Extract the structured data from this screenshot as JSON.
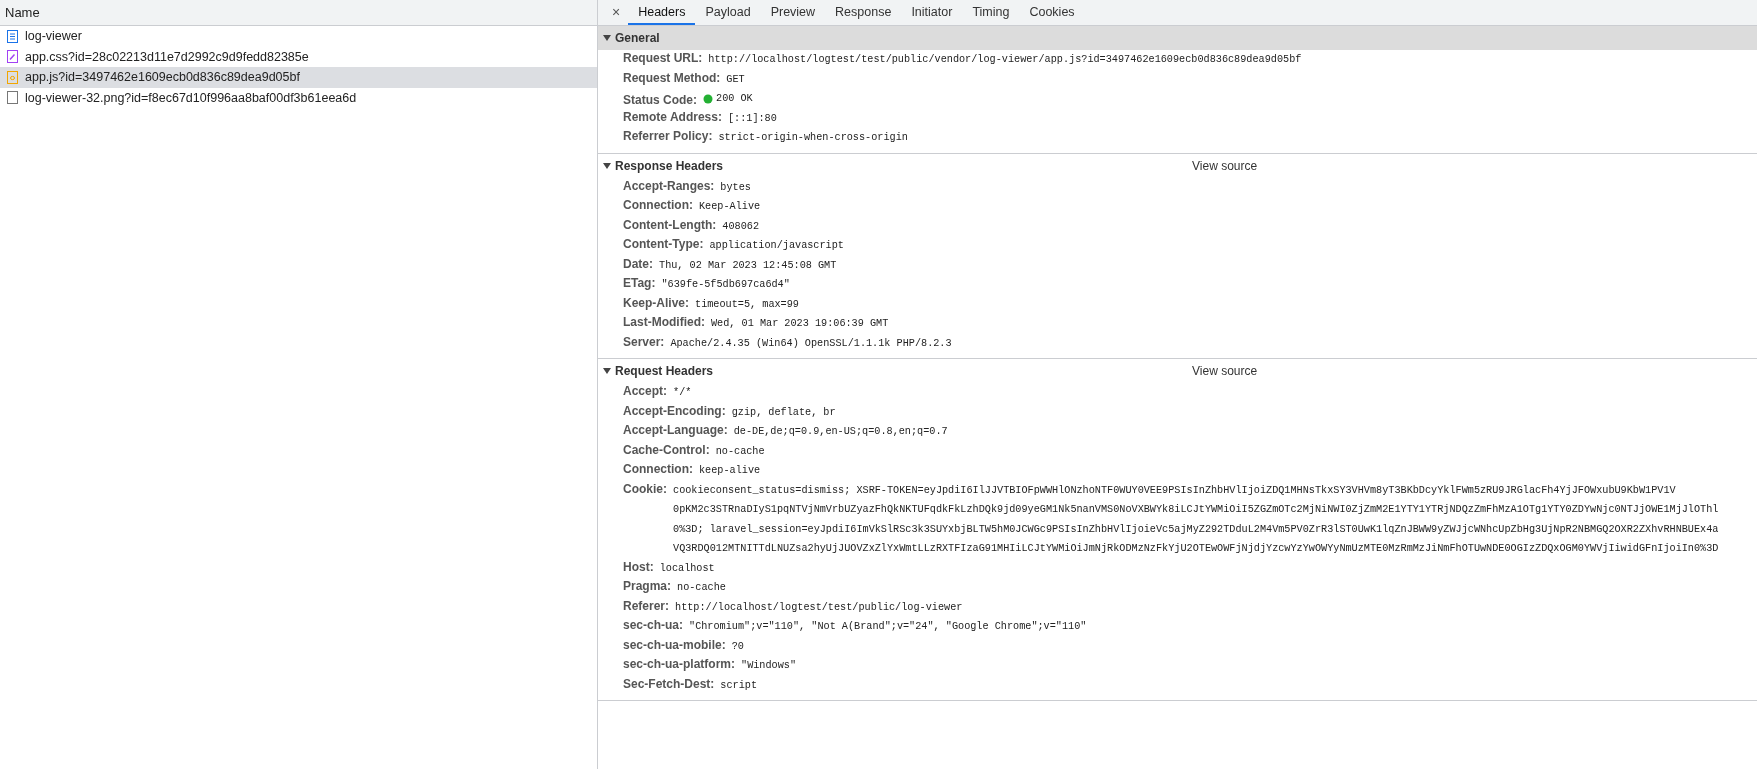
{
  "requests": {
    "column_header": "Name",
    "items": [
      {
        "name": "log-viewer",
        "kind": "document",
        "selected": false
      },
      {
        "name": "app.css?id=28c02213d11e7d2992c9d9fedd82385e",
        "kind": "stylesheet",
        "selected": false
      },
      {
        "name": "app.js?id=3497462e1609ecb0d836c89dea9d05bf",
        "kind": "script",
        "selected": true
      },
      {
        "name": "log-viewer-32.png?id=f8ec67d10f996aa8baf00df3b61eea6d",
        "kind": "image",
        "selected": false
      }
    ]
  },
  "details": {
    "close": "×",
    "tabs": [
      {
        "label": "Headers",
        "selected": true
      },
      {
        "label": "Payload",
        "selected": false
      },
      {
        "label": "Preview",
        "selected": false
      },
      {
        "label": "Response",
        "selected": false
      },
      {
        "label": "Initiator",
        "selected": false
      },
      {
        "label": "Timing",
        "selected": false
      },
      {
        "label": "Cookies",
        "selected": false
      }
    ],
    "sections": [
      {
        "title": "General",
        "expanded": true,
        "shaded": true,
        "rows": [
          {
            "kind": "plain",
            "name": "Request URL:",
            "value": [
              "http://localhost/logtest/test/public/vendor/log-viewer/app.js?id=3497462e1609ecb0d836c89dea9d05bf"
            ]
          },
          {
            "kind": "plain",
            "name": "Request Method:",
            "value": [
              "GET"
            ]
          },
          {
            "kind": "status",
            "name": "Status Code:",
            "value": [
              "200 OK"
            ]
          },
          {
            "kind": "plain",
            "name": "Remote Address:",
            "value": [
              "[::1]:80"
            ]
          },
          {
            "kind": "plain",
            "name": "Referrer Policy:",
            "value": [
              "strict-origin-when-cross-origin"
            ]
          }
        ]
      },
      {
        "title": "Response Headers",
        "expanded": true,
        "shaded": false,
        "link": "View source",
        "rows": [
          {
            "kind": "plain",
            "name": "Accept-Ranges:",
            "value": [
              "bytes"
            ]
          },
          {
            "kind": "plain",
            "name": "Connection:",
            "value": [
              "Keep-Alive"
            ]
          },
          {
            "kind": "plain",
            "name": "Content-Length:",
            "value": [
              "408062"
            ]
          },
          {
            "kind": "plain",
            "name": "Content-Type:",
            "value": [
              "application/javascript"
            ]
          },
          {
            "kind": "plain",
            "name": "Date:",
            "value": [
              "Thu, 02 Mar 2023 12:45:08 GMT"
            ]
          },
          {
            "kind": "plain",
            "name": "ETag:",
            "value": [
              "\"639fe-5f5db697ca6d4\""
            ]
          },
          {
            "kind": "plain",
            "name": "Keep-Alive:",
            "value": [
              "timeout=5, max=99"
            ]
          },
          {
            "kind": "plain",
            "name": "Last-Modified:",
            "value": [
              "Wed, 01 Mar 2023 19:06:39 GMT"
            ]
          },
          {
            "kind": "plain",
            "name": "Server:",
            "value": [
              "Apache/2.4.35 (Win64) OpenSSL/1.1.1k PHP/8.2.3"
            ]
          }
        ]
      },
      {
        "title": "Request Headers",
        "expanded": true,
        "shaded": false,
        "link": "View source",
        "rows": [
          {
            "kind": "plain",
            "name": "Accept:",
            "value": [
              "*/*"
            ]
          },
          {
            "kind": "plain",
            "name": "Accept-Encoding:",
            "value": [
              "gzip, deflate, br"
            ]
          },
          {
            "kind": "plain",
            "name": "Accept-Language:",
            "value": [
              "de-DE,de;q=0.9,en-US;q=0.8,en;q=0.7"
            ]
          },
          {
            "kind": "plain",
            "name": "Cache-Control:",
            "value": [
              "no-cache"
            ]
          },
          {
            "kind": "plain",
            "name": "Connection:",
            "value": [
              "keep-alive"
            ]
          },
          {
            "kind": "plain",
            "name": "Cookie:",
            "value": [
              "cookieconsent_status=dismiss; XSRF-TOKEN=eyJpdiI6IlJJVTBIOFpWWHlONzhoNTF0WUY0VEE9PSIsInZhbHVlIjoiZDQ1MHNsTkxSY3VHVm8yT3BKbDcyYklFWm5zRU9JRGlacFh4YjJFOWxubU9KbW1PV1V",
              "0pKM2c3STRnaDIyS1pqNTVjNmVrbUZyazFhQkNKTUFqdkFkLzhDQk9jd09yeGM1Nk5nanVMS0NoVXBWYk8iLCJtYWMiOiI5ZGZmOTc2MjNiNWI0ZjZmM2E1YTY1YTRjNDQzZmFhMzA1OTg1YTY0ZDYwNjc0NTJjOWE1MjJlOThl",
              "0%3D; laravel_session=eyJpdiI6ImVkSlRSc3k3SUYxbjBLTW5hM0JCWGc9PSIsInZhbHVlIjoieVc5ajMyZ292TDduL2M4Vm5PV0ZrR3lST0UwK1lqZnJBWW9yZWJjcWNhcUpZbHg3UjNpR2NBMGQ2OXR2ZXhvRHNBUEx4a",
              "VQ3RDQ012MTNITTdLNUZsa2hyUjJUOVZxZlYxWmtLLzRXTFIzaG91MHIiLCJtYWMiOiJmNjRkODMzNzFkYjU2OTEwOWFjNjdjYzcwYzYwOWYyNmUzMTE0MzRmMzJiNmFhOTUwNDE0OGIzZDQxOGM0YWVjIiwidGFnIjoiIn0%3D"
            ]
          },
          {
            "kind": "plain",
            "name": "Host:",
            "value": [
              "localhost"
            ]
          },
          {
            "kind": "plain",
            "name": "Pragma:",
            "value": [
              "no-cache"
            ]
          },
          {
            "kind": "plain",
            "name": "Referer:",
            "value": [
              "http://localhost/logtest/test/public/log-viewer"
            ]
          },
          {
            "kind": "plain",
            "name": "sec-ch-ua:",
            "value": [
              "\"Chromium\";v=\"110\", \"Not A(Brand\";v=\"24\", \"Google Chrome\";v=\"110\""
            ]
          },
          {
            "kind": "plain",
            "name": "sec-ch-ua-mobile:",
            "value": [
              "?0"
            ]
          },
          {
            "kind": "plain",
            "name": "sec-ch-ua-platform:",
            "value": [
              "\"Windows\""
            ]
          },
          {
            "kind": "plain",
            "name": "Sec-Fetch-Dest:",
            "value": [
              "script"
            ]
          }
        ]
      }
    ]
  }
}
